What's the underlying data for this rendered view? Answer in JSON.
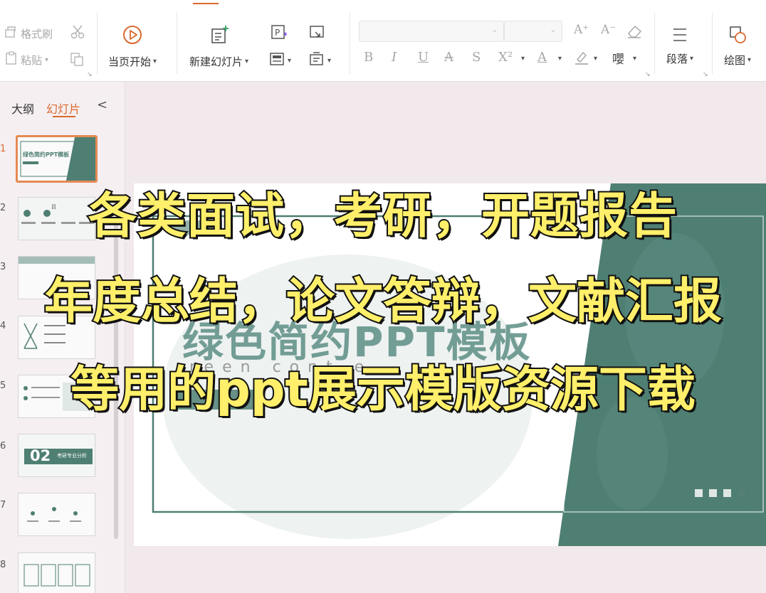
{
  "ribbon": {
    "clipboard": {
      "format_painter": "格式刷",
      "paste": "粘贴"
    },
    "slideshow_from_current": "当页开始",
    "new_slide": "新建幻灯片",
    "paragraph": "段落",
    "drawing": "绘图",
    "format_buttons": [
      "B",
      "I",
      "U",
      "A",
      "S",
      "X²",
      "A"
    ],
    "icons": [
      "format-painter-icon",
      "scissors-icon",
      "paste-icon",
      "copy-icon",
      "play-icon",
      "new-slide-icon",
      "paragraph-icon",
      "drawing-icon",
      "eraser-icon"
    ]
  },
  "left_panel": {
    "tab_outline": "大纲",
    "tab_slides": "幻灯片",
    "collapse_glyph": "<",
    "active_slide": 1,
    "slide_numbers": [
      "1",
      "2",
      "3",
      "4",
      "5",
      "6",
      "7",
      "8"
    ],
    "thumb1_title": "绿色简约PPT模板",
    "thumb2_title": "目",
    "thumb6_number": "02",
    "thumb6_title": "考研专业分析"
  },
  "slide": {
    "title": "绿色简约PPT模板",
    "subtitle": "reen  cont  e",
    "colors": {
      "green": "#4f7f73",
      "accent": "#d9692e"
    }
  },
  "overlay": {
    "line1": "各类面试，考研，开题报告",
    "line2": "年度总结，论文答辩，文献汇报",
    "line3": "等用的ppt展示模版资源下载",
    "color": "#ffef6a"
  }
}
